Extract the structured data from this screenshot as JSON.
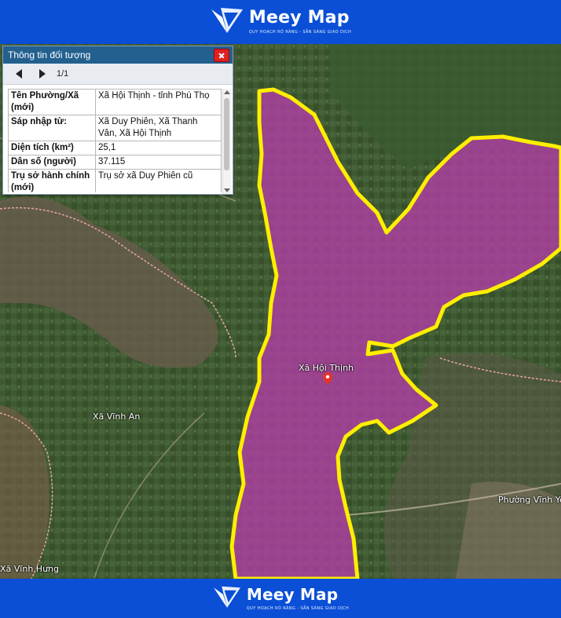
{
  "brand": {
    "name": "Meey Map",
    "tagline": "QUY HOẠCH RÕ RÀNG - SẴN SÀNG GIAO DỊCH",
    "color": "#0a4fd6"
  },
  "panel": {
    "title": "Thông tin đối tượng",
    "pager": "1/1",
    "rows": [
      {
        "label": "Tên Phường/Xã (mới)",
        "value": "Xã Hội Thịnh - tỉnh Phú Thọ"
      },
      {
        "label": "Sáp nhập từ:",
        "value": "Xã Duy Phiên, Xã Thanh Vân, Xã Hội Thịnh"
      },
      {
        "label": "Diện tích (km²)",
        "value": "25,1"
      },
      {
        "label": "Dân số (người)",
        "value": "37.115"
      },
      {
        "label": "Trụ sở hành chính (mới)",
        "value": "Trụ sở xã Duy Phiên cũ"
      }
    ]
  },
  "map": {
    "highlight_fill": "#b43ca8",
    "boundary_color": "#ffee00",
    "labels": {
      "center": "Xã Hội Thịnh",
      "vinh_an": "Xã Vĩnh An",
      "vinh_yen": "Phường Vĩnh Yên",
      "vinh_hung": "Xã Vĩnh Hưng"
    }
  }
}
